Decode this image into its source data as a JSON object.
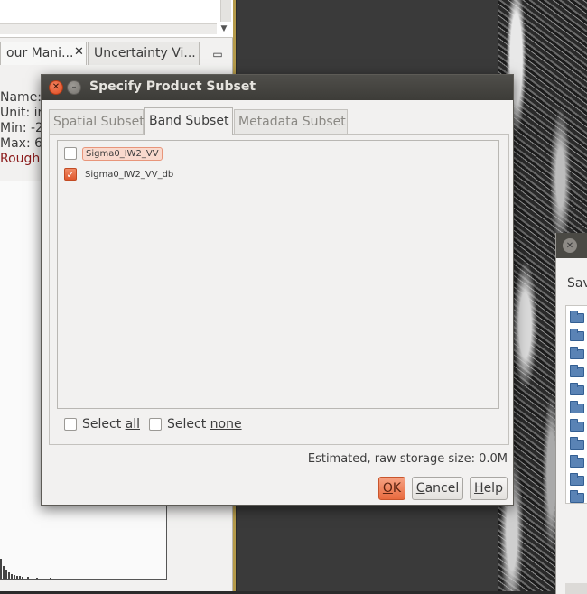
{
  "background": {
    "left_tabs": {
      "contour_label": "our Mani...",
      "contour_close": "✕",
      "uncertainty_label": "Uncertainty Vi...",
      "minimize": "▭"
    },
    "info_lines": [
      "Name:",
      "Unit: ir",
      "Min: -2",
      "Max: 6",
      "Rough"
    ],
    "save_dialog": {
      "label": "Sav"
    }
  },
  "dialog": {
    "title": "Specify Product Subset",
    "close_glyph": "✕",
    "minimize_glyph": "–",
    "tabs": [
      {
        "label": "Spatial Subset",
        "selected": false
      },
      {
        "label": "Band Subset",
        "selected": true
      },
      {
        "label": "Metadata Subset",
        "selected": false
      }
    ],
    "bands": [
      {
        "label": "Sigma0_IW2_VV",
        "checked": false
      },
      {
        "label": "Sigma0_IW2_VV_db",
        "checked": true
      }
    ],
    "check_glyph": "✓",
    "select_all": {
      "prefix": "Select ",
      "mnemonic": "all"
    },
    "select_none": {
      "prefix": "Select ",
      "mnemonic": "none"
    },
    "storage_label": "Estimated, raw storage size: 0.0M",
    "buttons": {
      "ok": {
        "mnemonic": "O",
        "rest": "K"
      },
      "cancel": {
        "mnemonic": "C",
        "rest": "ancel"
      },
      "help": {
        "mnemonic": "H",
        "rest": "elp"
      }
    }
  },
  "colors": {
    "accent": "#e86a3e",
    "titlebar": "#3d3c38",
    "dialog_bg": "#f2f1f0"
  }
}
